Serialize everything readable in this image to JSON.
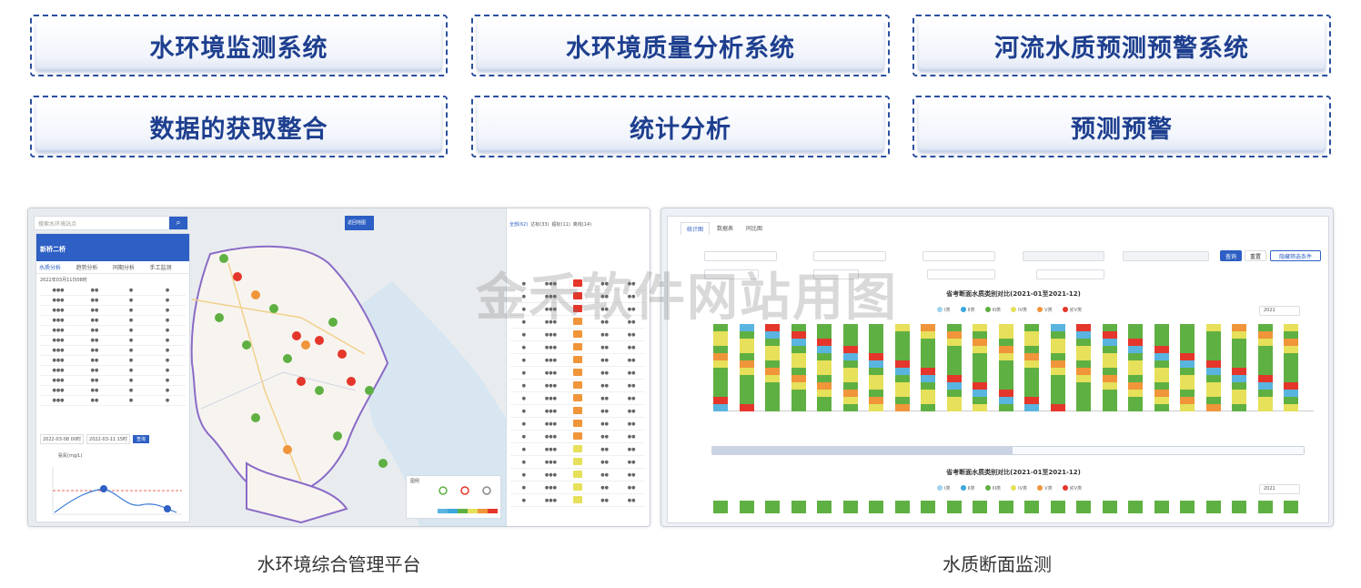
{
  "modules": [
    {
      "label": "水环境监测系统"
    },
    {
      "label": "水环境质量分析系统"
    },
    {
      "label": "河流水质预测预警系统"
    },
    {
      "label": "数据的获取整合"
    },
    {
      "label": "统计分析"
    },
    {
      "label": "预测预警"
    }
  ],
  "captions": {
    "left": "水环境综合管理平台",
    "right": "水质断面监测"
  },
  "colors": {
    "accent": "#2d5fc4",
    "grade_1": "#5ab4e0",
    "grade_2": "#3aa8dd",
    "grade_3": "#5fb043",
    "grade_4": "#e6e05a",
    "grade_5": "#f0953a",
    "grade_bad": "#e5362b"
  },
  "left_app": {
    "search_placeholder": "搜索水环境站点",
    "toolbar_btn": "返回地图",
    "station_title": "新桥二桥",
    "tabs": [
      "水质分析",
      "趋势分析",
      "同期分析",
      "手工监测"
    ],
    "date_label": "2022年03月11日08时",
    "query_btn": "查询",
    "date_from": "2022-03-08 00时",
    "date_to": "2022-03-11 15时",
    "trend_title": "氨氮(mg/L)",
    "right_tabs": [
      "全部(62)",
      "达标(33)",
      "超标(11)",
      "离线(14)"
    ],
    "legend_title": "图例"
  },
  "right_app": {
    "tabs": [
      "统计图",
      "数据表",
      "同比图"
    ],
    "query_btn": "查询",
    "reset_btn": "重置",
    "export_btn": "隐藏筛选条件",
    "chart_title": "省考断面水质类别对比(2021-01至2021-12)",
    "year": "2021",
    "legend": [
      "I类",
      "II类",
      "III类",
      "IV类",
      "V类",
      "劣V类"
    ]
  },
  "watermark": "金禾软件网站用图"
}
